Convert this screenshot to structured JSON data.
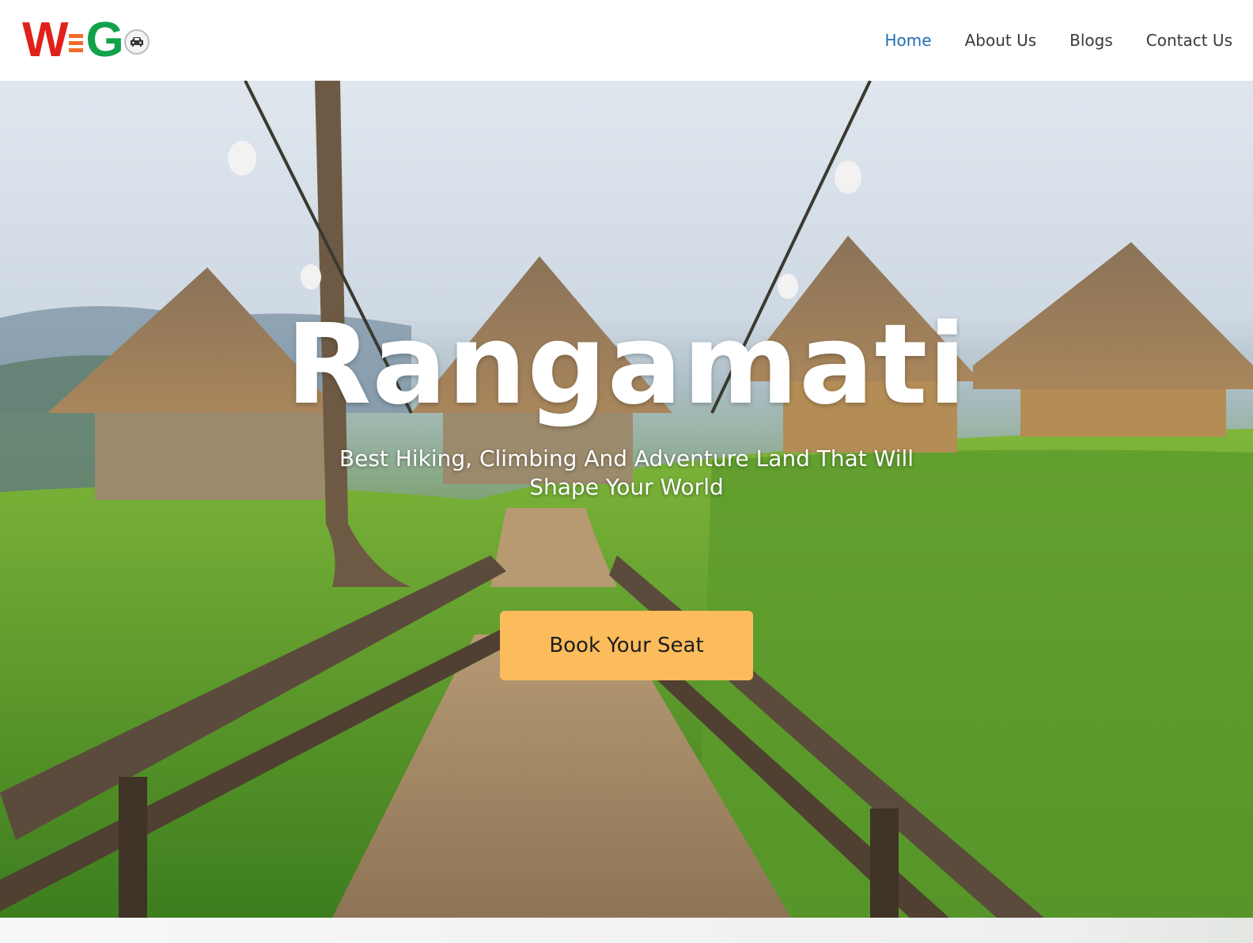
{
  "header": {
    "logo": {
      "letter_w": "W",
      "letter_g": "G",
      "icon": "car-icon"
    },
    "nav": [
      {
        "label": "Home",
        "active": true
      },
      {
        "label": "About Us",
        "active": false
      },
      {
        "label": "Blogs",
        "active": false
      },
      {
        "label": "Contact Us",
        "active": false
      }
    ]
  },
  "hero": {
    "title": "Rangamati",
    "subtitle": "Best Hiking, Climbing And Adventure Land That Will Shape Your World",
    "cta_label": "Book Your Seat",
    "background_image": "thatched huts on green hills with wooden bridge"
  },
  "colors": {
    "nav_active": "#1f6fb2",
    "nav_text": "#3a3a3a",
    "cta_bg": "#fcbc5b",
    "logo_red": "#e0201b",
    "logo_orange": "#f26b2b",
    "logo_green": "#12a24a"
  }
}
